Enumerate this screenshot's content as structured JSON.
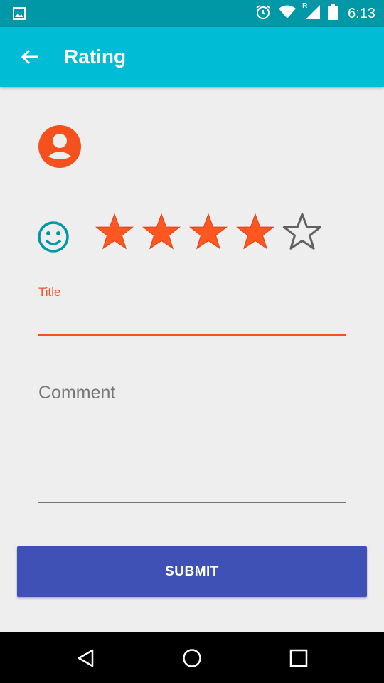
{
  "status_bar": {
    "time": "6:13",
    "icons": [
      "image-icon",
      "alarm-icon",
      "wifi-icon",
      "signal-icon",
      "battery-icon"
    ],
    "roaming_indicator": "R"
  },
  "app_bar": {
    "title": "Rating",
    "back_icon": "arrow-back-icon",
    "color": "#00bcd4"
  },
  "profile": {
    "avatar_icon": "account-circle-icon",
    "color": "#f4511e"
  },
  "rating": {
    "icon": "smiley-icon",
    "value": 4,
    "max": 5,
    "filled_color": "#ff5722",
    "empty_color": "#616161"
  },
  "form": {
    "title_label": "Title",
    "title_value": "",
    "comment_placeholder": "Comment",
    "comment_value": "",
    "accent_color": "#f4511e"
  },
  "submit": {
    "label": "SUBMIT",
    "color": "#3f51b5"
  },
  "nav_bar": {
    "icons": [
      "back-triangle-icon",
      "home-circle-icon",
      "recents-square-icon"
    ]
  }
}
